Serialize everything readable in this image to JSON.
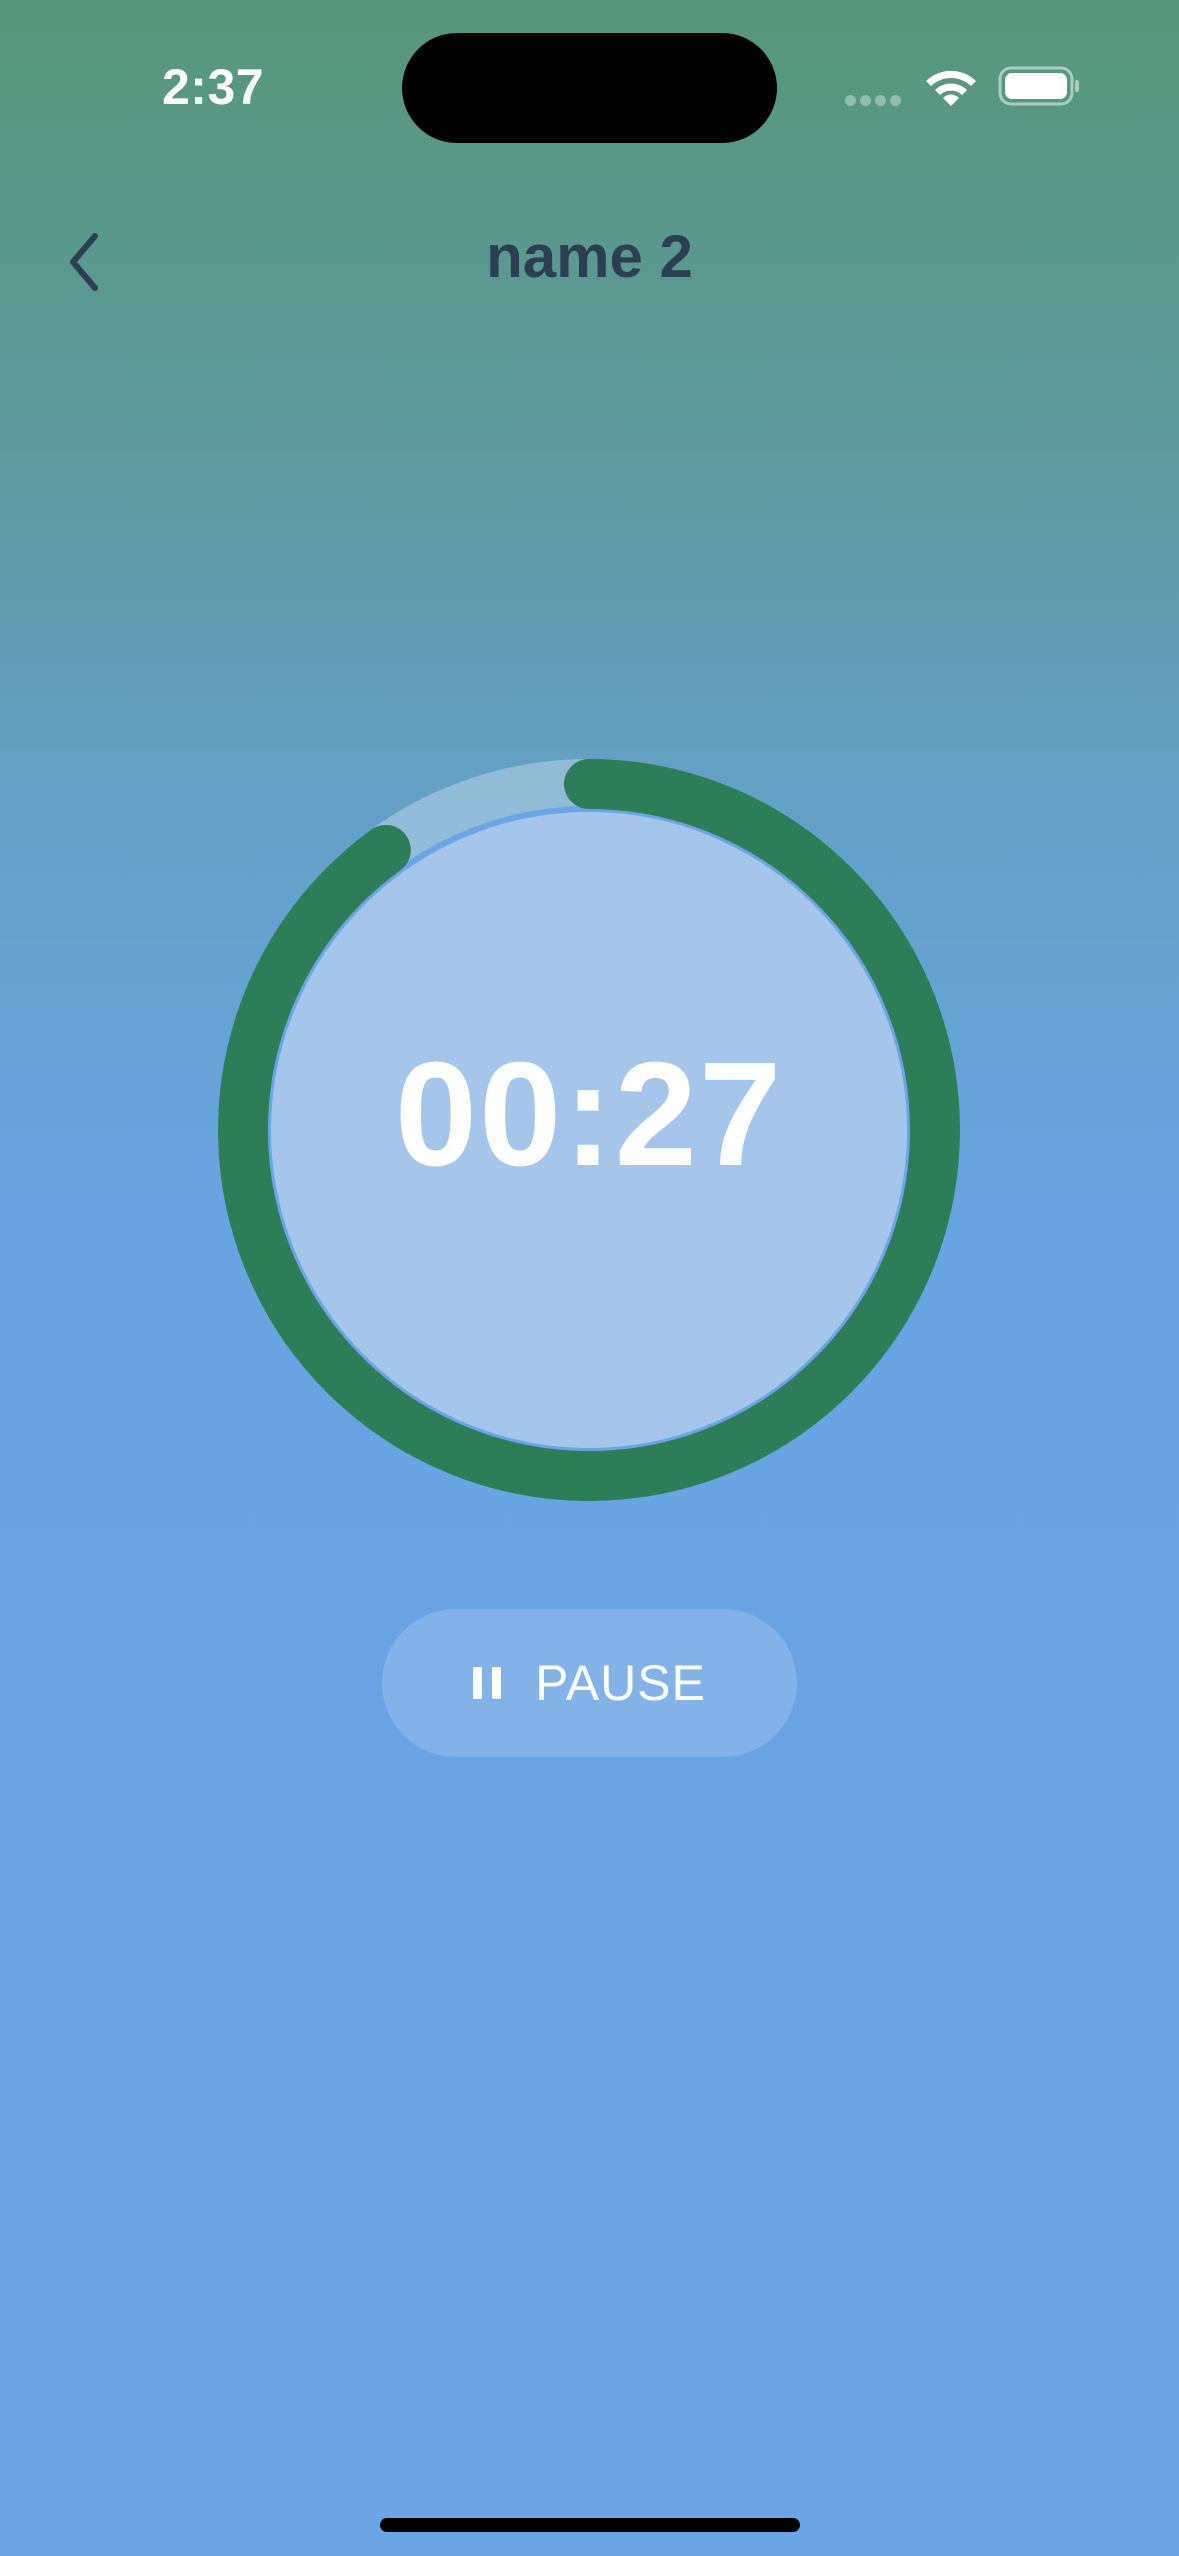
{
  "status_bar": {
    "time": "2:37",
    "icons": [
      "cellular-signal-icon",
      "wifi-icon",
      "battery-icon"
    ]
  },
  "header": {
    "back_icon": "chevron-left-icon",
    "title": "name 2"
  },
  "timer": {
    "display": "00:27",
    "progress": 0.9,
    "colors": {
      "progress": "#2e7d59",
      "track": "rgba(255,255,255,0.3)",
      "face": "#a5c6ea"
    }
  },
  "controls": {
    "pause_icon": "pause-icon",
    "pause_label": "PAUSE"
  },
  "theme": {
    "gradient_top": "#56977a",
    "gradient_bottom": "#6ba5e6",
    "title_color": "#2b3f50"
  }
}
